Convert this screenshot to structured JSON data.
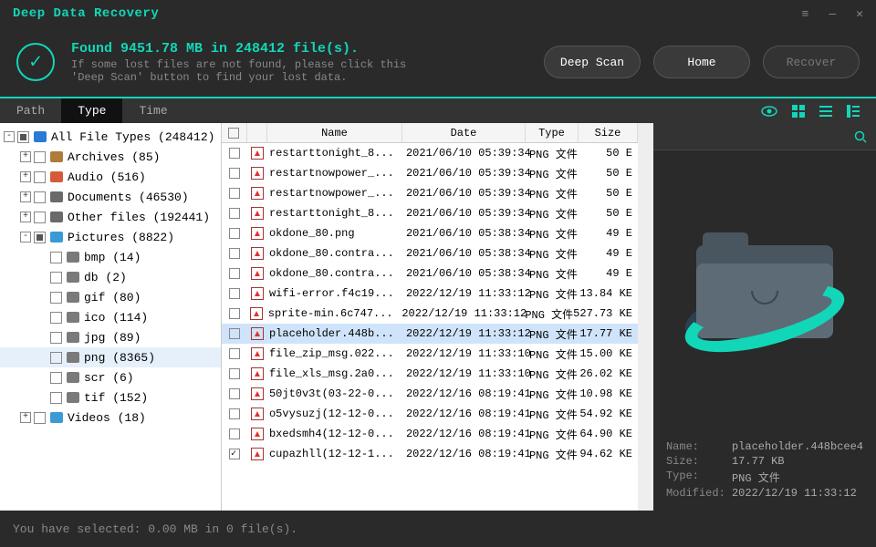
{
  "title": "Deep Data Recovery",
  "header": {
    "found": "Found 9451.78 MB in 248412 file(s).",
    "hint": "If some lost files are not found, please click this 'Deep Scan' button to find your lost data.",
    "deep_scan": "Deep Scan",
    "home": "Home",
    "recover": "Recover"
  },
  "tabs": {
    "path": "Path",
    "type": "Type",
    "time": "Time",
    "active": "type"
  },
  "tree": [
    {
      "indent": 0,
      "twist": "-",
      "tri": true,
      "icon_color": "#2a7ad6",
      "label": "All File Types (248412)"
    },
    {
      "indent": 1,
      "twist": "+",
      "tri": false,
      "icon_color": "#b07a3a",
      "label": "Archives (85)"
    },
    {
      "indent": 1,
      "twist": "+",
      "tri": false,
      "icon_color": "#d65a3a",
      "label": "Audio (516)"
    },
    {
      "indent": 1,
      "twist": "+",
      "tri": false,
      "icon_color": "#6a6a6a",
      "label": "Documents (46530)"
    },
    {
      "indent": 1,
      "twist": "+",
      "tri": false,
      "icon_color": "#6a6a6a",
      "label": "Other files (192441)"
    },
    {
      "indent": 1,
      "twist": "-",
      "tri": true,
      "icon_color": "#3a9ad6",
      "label": "Pictures (8822)"
    },
    {
      "indent": 2,
      "twist": "",
      "tri": false,
      "icon_color": "#7a7a7a",
      "label": "bmp (14)"
    },
    {
      "indent": 2,
      "twist": "",
      "tri": false,
      "icon_color": "#7a7a7a",
      "label": "db (2)"
    },
    {
      "indent": 2,
      "twist": "",
      "tri": false,
      "icon_color": "#7a7a7a",
      "label": "gif (80)"
    },
    {
      "indent": 2,
      "twist": "",
      "tri": false,
      "icon_color": "#7a7a7a",
      "label": "ico (114)"
    },
    {
      "indent": 2,
      "twist": "",
      "tri": false,
      "icon_color": "#7a7a7a",
      "label": "jpg (89)"
    },
    {
      "indent": 2,
      "twist": "",
      "tri": false,
      "icon_color": "#7a7a7a",
      "label": "png (8365)",
      "selected": true
    },
    {
      "indent": 2,
      "twist": "",
      "tri": false,
      "icon_color": "#7a7a7a",
      "label": "scr (6)"
    },
    {
      "indent": 2,
      "twist": "",
      "tri": false,
      "icon_color": "#7a7a7a",
      "label": "tif (152)"
    },
    {
      "indent": 1,
      "twist": "+",
      "tri": false,
      "icon_color": "#3a9ad6",
      "label": "Videos (18)"
    }
  ],
  "cols": {
    "name": "Name",
    "date": "Date",
    "type": "Type",
    "size": "Size"
  },
  "rows": [
    {
      "checked": false,
      "name": "restarttonight_8...",
      "date": "2021/06/10 05:39:34",
      "type": "PNG 文件",
      "size": "50 E"
    },
    {
      "checked": false,
      "name": "restartnowpower_...",
      "date": "2021/06/10 05:39:34",
      "type": "PNG 文件",
      "size": "50 E"
    },
    {
      "checked": false,
      "name": "restartnowpower_...",
      "date": "2021/06/10 05:39:34",
      "type": "PNG 文件",
      "size": "50 E"
    },
    {
      "checked": false,
      "name": "restarttonight_8...",
      "date": "2021/06/10 05:39:34",
      "type": "PNG 文件",
      "size": "50 E"
    },
    {
      "checked": false,
      "name": "okdone_80.png",
      "date": "2021/06/10 05:38:34",
      "type": "PNG 文件",
      "size": "49 E"
    },
    {
      "checked": false,
      "name": "okdone_80.contra...",
      "date": "2021/06/10 05:38:34",
      "type": "PNG 文件",
      "size": "49 E"
    },
    {
      "checked": false,
      "name": "okdone_80.contra...",
      "date": "2021/06/10 05:38:34",
      "type": "PNG 文件",
      "size": "49 E"
    },
    {
      "checked": false,
      "name": "wifi-error.f4c19...",
      "date": "2022/12/19 11:33:12",
      "type": "PNG 文件",
      "size": "13.84 KE"
    },
    {
      "checked": false,
      "name": "sprite-min.6c747...",
      "date": "2022/12/19 11:33:12",
      "type": "PNG 文件",
      "size": "527.73 KE"
    },
    {
      "checked": false,
      "name": "placeholder.448b...",
      "date": "2022/12/19 11:33:12",
      "type": "PNG 文件",
      "size": "17.77 KE",
      "selected": true
    },
    {
      "checked": false,
      "name": "file_zip_msg.022...",
      "date": "2022/12/19 11:33:10",
      "type": "PNG 文件",
      "size": "15.00 KE"
    },
    {
      "checked": false,
      "name": "file_xls_msg.2a0...",
      "date": "2022/12/19 11:33:10",
      "type": "PNG 文件",
      "size": "26.02 KE"
    },
    {
      "checked": false,
      "name": "50jt0v3t(03-22-0...",
      "date": "2022/12/16 08:19:41",
      "type": "PNG 文件",
      "size": "10.98 KE"
    },
    {
      "checked": false,
      "name": "o5vysuzj(12-12-0...",
      "date": "2022/12/16 08:19:41",
      "type": "PNG 文件",
      "size": "54.92 KE"
    },
    {
      "checked": false,
      "name": "bxedsmh4(12-12-0...",
      "date": "2022/12/16 08:19:41",
      "type": "PNG 文件",
      "size": "64.90 KE"
    },
    {
      "checked": true,
      "name": "cupazhll(12-12-1...",
      "date": "2022/12/16 08:19:41",
      "type": "PNG 文件",
      "size": "94.62 KE"
    }
  ],
  "meta": {
    "name_l": "Name:",
    "name_v": "placeholder.448bcee4",
    "size_l": "Size:",
    "size_v": "17.77 KB",
    "type_l": "Type:",
    "type_v": "PNG 文件",
    "mod_l": "Modified:",
    "mod_v": "2022/12/19 11:33:12"
  },
  "status": "You have selected: 0.00 MB in 0 file(s)."
}
